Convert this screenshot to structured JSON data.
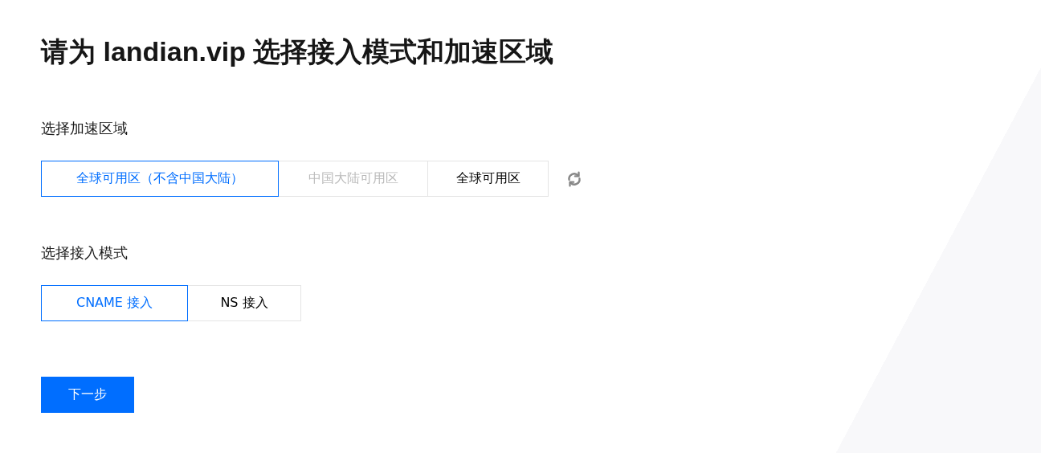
{
  "title": "请为 landian.vip 选择接入模式和加速区域",
  "region": {
    "label": "选择加速区域",
    "options": [
      {
        "label": "全球可用区（不含中国大陆）",
        "selected": true,
        "disabled": false
      },
      {
        "label": "中国大陆可用区",
        "selected": false,
        "disabled": true
      },
      {
        "label": "全球可用区",
        "selected": false,
        "disabled": false
      }
    ]
  },
  "mode": {
    "label": "选择接入模式",
    "options": [
      {
        "label": "CNAME 接入",
        "selected": true,
        "disabled": false
      },
      {
        "label": "NS 接入",
        "selected": false,
        "disabled": false
      }
    ]
  },
  "next_button": "下一步"
}
